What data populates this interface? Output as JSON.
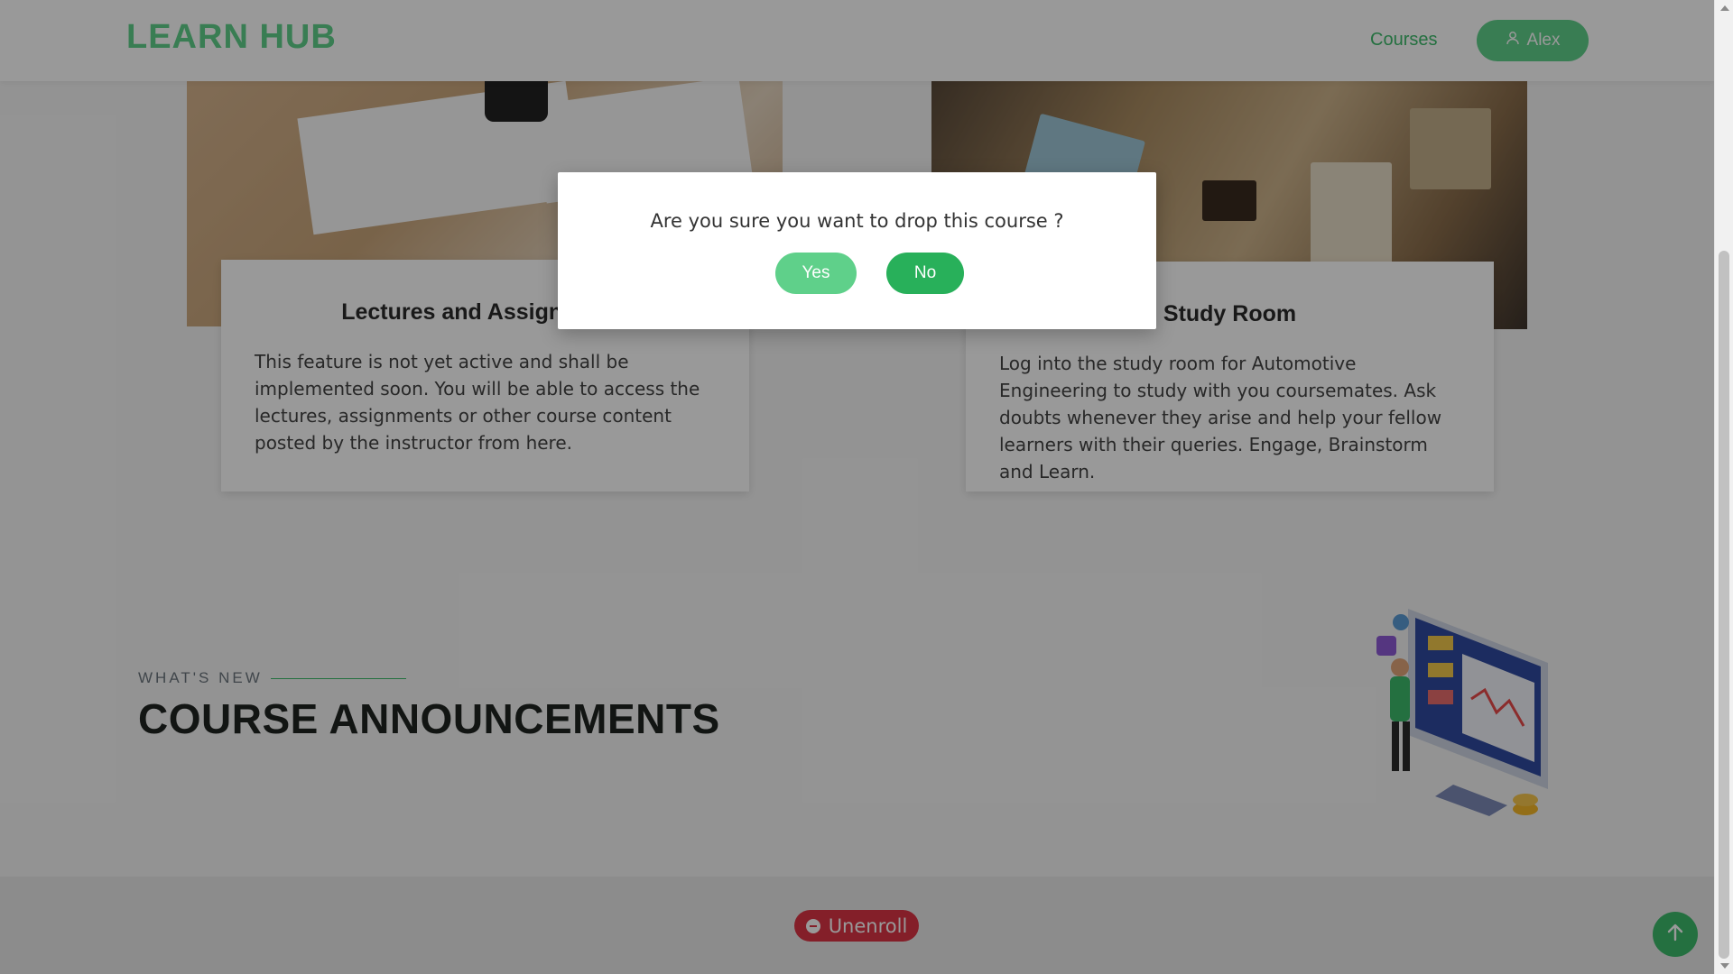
{
  "header": {
    "brand": "LEARN HUB",
    "nav_courses": "Courses",
    "user_name": "Alex"
  },
  "cards": [
    {
      "title": "Lectures and Assignments",
      "body": "This feature is not yet active and shall be implemented soon. You will be able to access the lectures, assignments or other course content posted by the instructor from here."
    },
    {
      "title": "Study Room",
      "body": "Log into the study room for Automotive Engineering to study with you coursemates. Ask doubts whenever they arise and help your fellow learners with their queries. Engage, Brainstorm and Learn."
    }
  ],
  "announcements": {
    "kicker": "WHAT'S NEW",
    "title": "COURSE ANNOUNCEMENTS"
  },
  "footer": {
    "unenroll_label": "Unenroll"
  },
  "modal": {
    "message": "Are you sure you want to drop this course ?",
    "yes_label": "Yes",
    "no_label": "No"
  },
  "colors": {
    "brand_green": "#5fd08a",
    "primary_green": "#28b05a",
    "danger_red": "#dc3545"
  }
}
